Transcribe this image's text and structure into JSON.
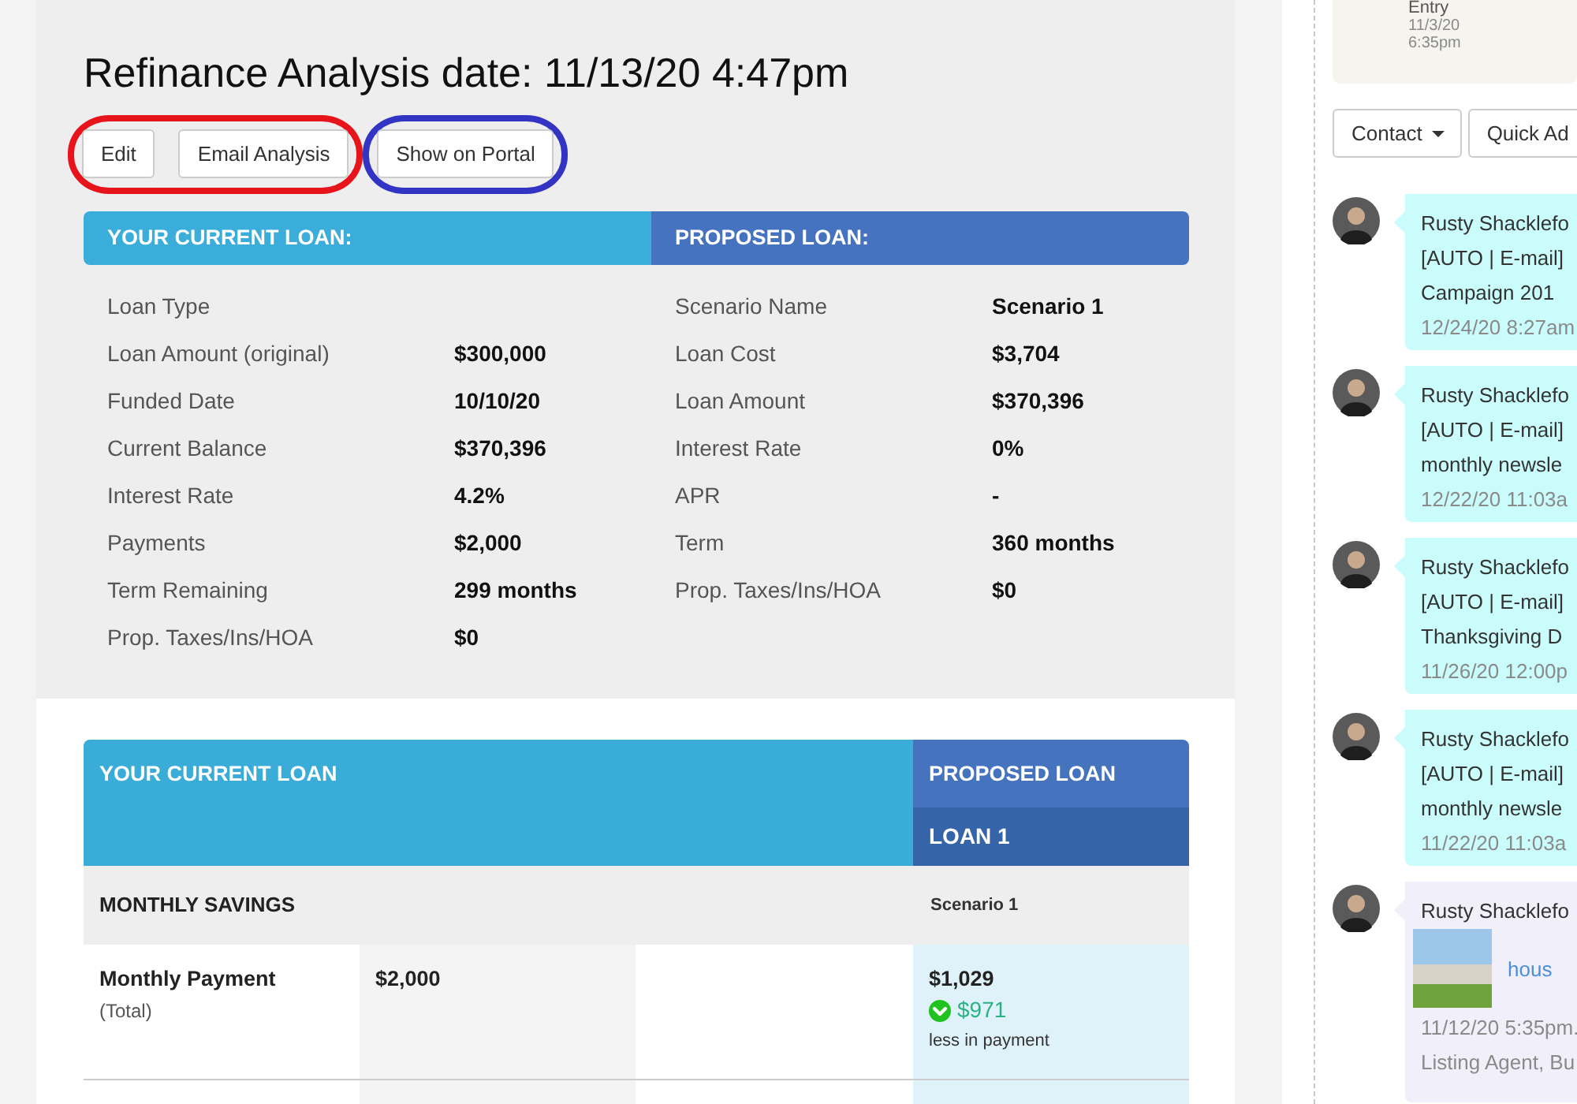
{
  "title": "Refinance Analysis date: 11/13/20 4:47pm",
  "button_groups": [
    {
      "color": "#e8141c",
      "buttons": [
        "Edit",
        "Email Analysis"
      ]
    },
    {
      "color": "#3434c4",
      "buttons": [
        "Show on Portal"
      ]
    }
  ],
  "summary": {
    "columns": [
      {
        "kind": "current",
        "heading": "YOUR CURRENT LOAN:",
        "rows": [
          {
            "label": "Loan Type"
          },
          {
            "label": "Loan Amount (original)",
            "value": "$300,000"
          },
          {
            "label": "Funded Date",
            "value": "10/10/20"
          },
          {
            "label": "Current Balance",
            "value": "$370,396"
          },
          {
            "label": "Interest Rate",
            "value": "4.2%"
          },
          {
            "label": "Payments",
            "value": "$2,000"
          },
          {
            "label": "Term Remaining",
            "value": "299 months"
          },
          {
            "label": "Prop. Taxes/Ins/HOA",
            "value": "$0"
          }
        ]
      },
      {
        "kind": "proposed",
        "heading": "PROPOSED LOAN:",
        "rows": [
          {
            "label": "Scenario Name",
            "value": "Scenario 1"
          },
          {
            "label": "Loan Cost",
            "value": "$3,704"
          },
          {
            "label": "Loan Amount",
            "value": "$370,396"
          },
          {
            "label": "Interest Rate",
            "value": "0%"
          },
          {
            "label": "APR",
            "value": "-"
          },
          {
            "label": "Term",
            "value": "360 months"
          },
          {
            "label": "Prop. Taxes/Ins/HOA",
            "value": "$0"
          }
        ]
      }
    ]
  },
  "comparison": {
    "current_heading": "YOUR CURRENT LOAN",
    "proposed_heading": "PROPOSED LOAN",
    "loan_heading": "LOAN 1",
    "section_label": "MONTHLY SAVINGS",
    "scenario": "Scenario 1",
    "rows": [
      {
        "label": "Monthly Payment",
        "sublabel": "(Total)",
        "current": "$2,000",
        "proposed": "$1,029",
        "savings": "$971",
        "savings_note": "less in payment"
      }
    ]
  },
  "sidebar": {
    "entry_card": {
      "title": "Entry",
      "date": "11/3/20",
      "time": "6:35pm"
    },
    "buttons": [
      {
        "kind": "dropdown",
        "label": "Contact"
      },
      {
        "kind": "plain",
        "label": "Quick Ad"
      }
    ],
    "feed": [
      {
        "kind": "email",
        "author": "Rusty Shacklefo",
        "lines": [
          "[AUTO | E-mail]",
          "Campaign 201"
        ],
        "time": "12/24/20 8:27am"
      },
      {
        "kind": "email",
        "author": "Rusty Shacklefo",
        "lines": [
          "[AUTO | E-mail]",
          "monthly newsle"
        ],
        "time": "12/22/20 11:03a"
      },
      {
        "kind": "email",
        "author": "Rusty Shacklefo",
        "lines": [
          "[AUTO | E-mail]",
          "Thanksgiving D"
        ],
        "time": "11/26/20 12:00p"
      },
      {
        "kind": "email",
        "author": "Rusty Shacklefo",
        "lines": [
          "[AUTO | E-mail]",
          "monthly newsle"
        ],
        "time": "11/22/20 11:03a"
      },
      {
        "kind": "listing",
        "author": "Rusty Shacklefo",
        "link": "hous",
        "time": "11/12/20 5:35pm.",
        "note": "Listing Agent, Bu"
      }
    ]
  }
}
